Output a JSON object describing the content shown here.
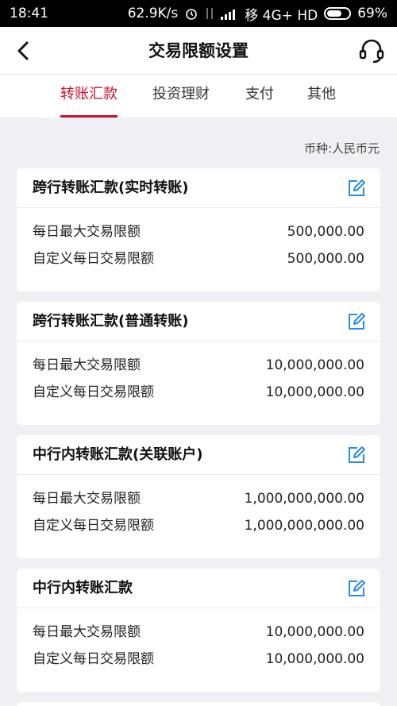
{
  "status_bar": {
    "time": "18:41",
    "speed": "62.9K/s",
    "carrier": "移 4G+ HD",
    "battery": "69%",
    "battery_level": 0.69
  },
  "header": {
    "title": "交易限额设置",
    "back_icon": "chevron-left-icon",
    "service_icon": "headset-icon"
  },
  "tabs": [
    {
      "label": "转账汇款",
      "active": true
    },
    {
      "label": "投资理财",
      "active": false
    },
    {
      "label": "支付",
      "active": false
    },
    {
      "label": "其他",
      "active": false
    }
  ],
  "currency_label": "币种:人民币元",
  "accent_color": "#c8102e",
  "edit_icon_color": "#2a8de0",
  "cards": [
    {
      "title": "跨行转账汇款(实时转账)",
      "rows": [
        {
          "label": "每日最大交易限额",
          "value": "500,000.00"
        },
        {
          "label": "自定义每日交易限额",
          "value": "500,000.00"
        }
      ]
    },
    {
      "title": "跨行转账汇款(普通转账)",
      "rows": [
        {
          "label": "每日最大交易限额",
          "value": "10,000,000.00"
        },
        {
          "label": "自定义每日交易限额",
          "value": "10,000,000.00"
        }
      ]
    },
    {
      "title": "中行内转账汇款(关联账户)",
      "rows": [
        {
          "label": "每日最大交易限额",
          "value": "1,000,000,000.00"
        },
        {
          "label": "自定义每日交易限额",
          "value": "1,000,000,000.00"
        }
      ]
    },
    {
      "title": "中行内转账汇款",
      "rows": [
        {
          "label": "每日最大交易限额",
          "value": "10,000,000.00"
        },
        {
          "label": "自定义每日交易限额",
          "value": "10,000,000.00"
        }
      ]
    }
  ]
}
